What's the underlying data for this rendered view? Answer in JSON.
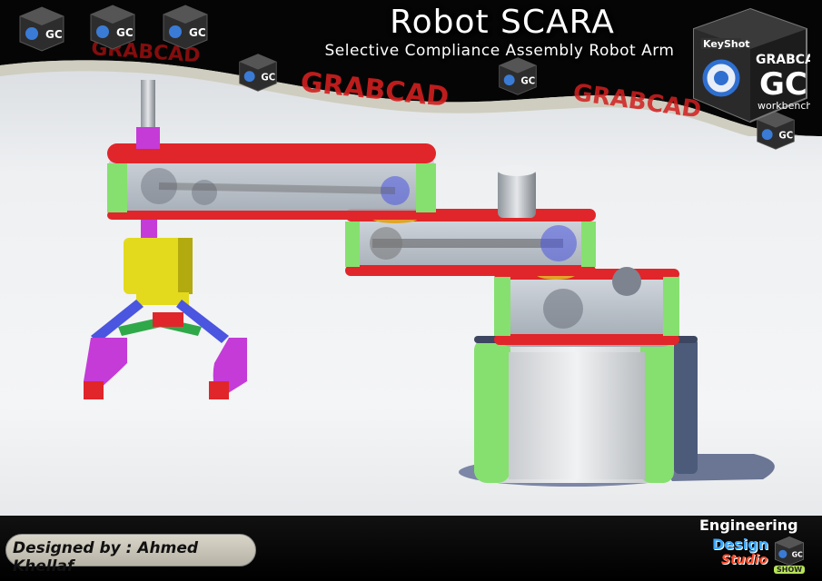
{
  "header": {
    "title": "Robot SCARA",
    "subtitle": "Selective Compliance Assembly Robot Arm"
  },
  "branding": {
    "brand_watermark": "GRABCAD",
    "cube_keyshot": "KeyShot",
    "cube_grabcad": "GRABCAD",
    "cube_gc": "GC",
    "cube_workbench": "workbench"
  },
  "footer": {
    "credit": "Designed by : Ahmed Khellaf",
    "studio_line1": "Engineering",
    "studio_line2": "Design",
    "studio_line3": "Studio",
    "studio_badge": "SHOW"
  },
  "colors": {
    "arm_red": "#e0262a",
    "arm_green": "#8fe07a",
    "arm_glass": "#b9c1cc",
    "gripper_yellow": "#e3da1e",
    "gripper_magenta": "#c43bd8",
    "gripper_blue": "#4a55e0",
    "base_gray": "#d9dcdf",
    "brand_red": "#d21f1f"
  }
}
